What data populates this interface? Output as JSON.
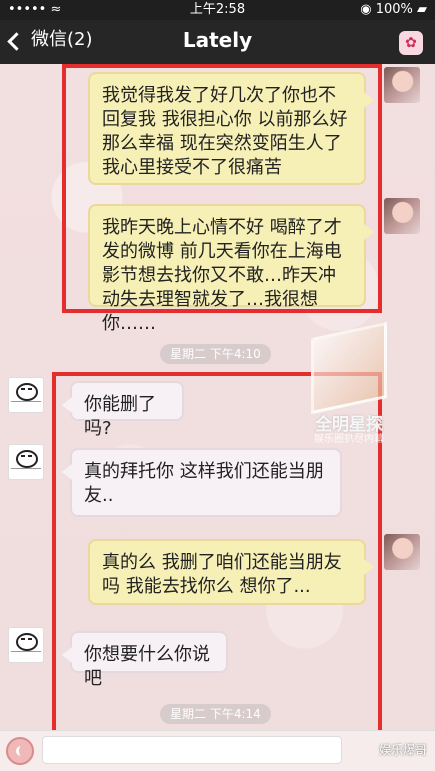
{
  "status": {
    "left": "••••• ≈",
    "time": "上午2:58",
    "right": "◉ 100% ▰"
  },
  "nav": {
    "back_label": "微信(2)",
    "title": "Lately",
    "action_icon": "sticker-icon"
  },
  "messages": {
    "m1": "我觉得我发了好几次了你也不回复我 我很担心你 以前那么好那么幸福 现在突然变陌生人了我心里接受不了很痛苦",
    "m2": "我昨天晚上心情不好 喝醉了才发的微博 前几天看你在上海电影节想去找你又不敢…昨天冲动失去理智就发了…我很想你……",
    "m3": "你能删了吗?",
    "m4": "真的拜托你 这样我们还能当朋友..",
    "m5": "真的么 我删了咱们还能当朋友吗 我能去找你么 想你了...",
    "m6": "你想要什么你说吧"
  },
  "time_pills": {
    "t1": "星期二 下午4:10",
    "t2": "星期二 下午4:14"
  },
  "watermark": {
    "label": "全明星探",
    "sub": "娱乐圈扒尽内幕"
  },
  "input": {
    "right_watermark": "娱乐爆哥"
  },
  "colors": {
    "highlight": "#e42d2d",
    "outgoing_bubble": "#f6f0b6",
    "incoming_bubble": "#f7f1f5"
  }
}
